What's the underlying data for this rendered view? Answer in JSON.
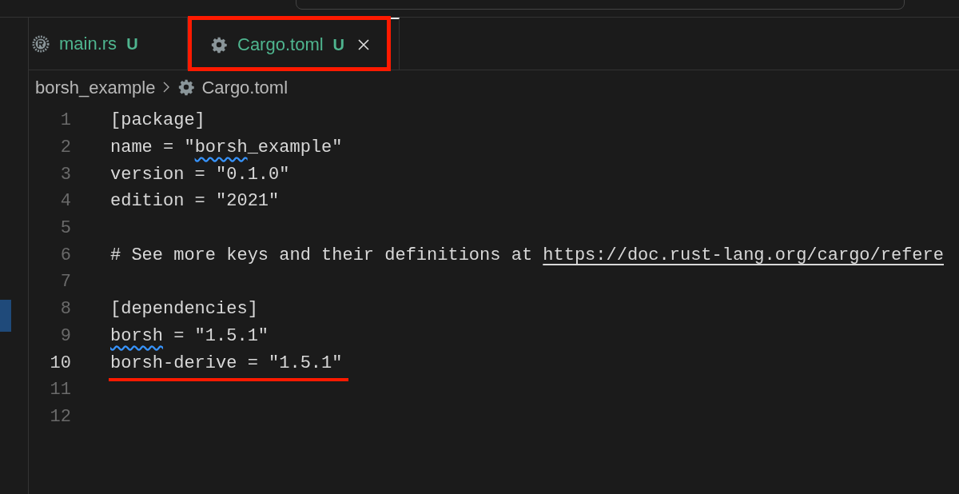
{
  "tabs": [
    {
      "label": "main.rs",
      "badge": "U",
      "selected": false,
      "annotated": false,
      "closable": false
    },
    {
      "label": "Cargo.toml",
      "badge": "U",
      "selected": true,
      "annotated": true,
      "closable": true
    }
  ],
  "breadcrumb": [
    {
      "label": "borsh_example"
    },
    {
      "label": "Cargo.toml"
    }
  ],
  "lines": [
    {
      "number": "1",
      "current": false,
      "annotated": false,
      "segments": [
        {
          "text": "[package]",
          "kind": "plain"
        }
      ]
    },
    {
      "number": "2",
      "current": false,
      "annotated": false,
      "segments": [
        {
          "text": "name = \"",
          "kind": "plain"
        },
        {
          "text": "borsh",
          "kind": "squiggle"
        },
        {
          "text": "_example\"",
          "kind": "plain"
        }
      ]
    },
    {
      "number": "3",
      "current": false,
      "annotated": false,
      "segments": [
        {
          "text": "version = \"0.1.0\"",
          "kind": "plain"
        }
      ]
    },
    {
      "number": "4",
      "current": false,
      "annotated": false,
      "segments": [
        {
          "text": "edition = \"2021\"",
          "kind": "plain"
        }
      ]
    },
    {
      "number": "5",
      "current": false,
      "annotated": false
    },
    {
      "number": "6",
      "current": false,
      "annotated": false,
      "segments": [
        {
          "text": "# See more keys and their definitions at ",
          "kind": "plain"
        },
        {
          "text": "https://doc.rust-lang.org/cargo/refere",
          "kind": "link"
        }
      ]
    },
    {
      "number": "7",
      "current": false,
      "annotated": false
    },
    {
      "number": "8",
      "current": false,
      "annotated": false,
      "segments": [
        {
          "text": "[dependencies]",
          "kind": "plain"
        }
      ]
    },
    {
      "number": "9",
      "current": false,
      "annotated": false,
      "segments": [
        {
          "text": "borsh",
          "kind": "squiggle"
        },
        {
          "text": " = \"1.5.1\"",
          "kind": "plain"
        }
      ]
    },
    {
      "number": "10",
      "current": true,
      "annotated": true,
      "segments": [
        {
          "text": "borsh-derive = \"1.5.1\"",
          "kind": "plain"
        }
      ]
    },
    {
      "number": "11",
      "current": false,
      "annotated": false
    },
    {
      "number": "12",
      "current": false,
      "annotated": false
    }
  ]
}
